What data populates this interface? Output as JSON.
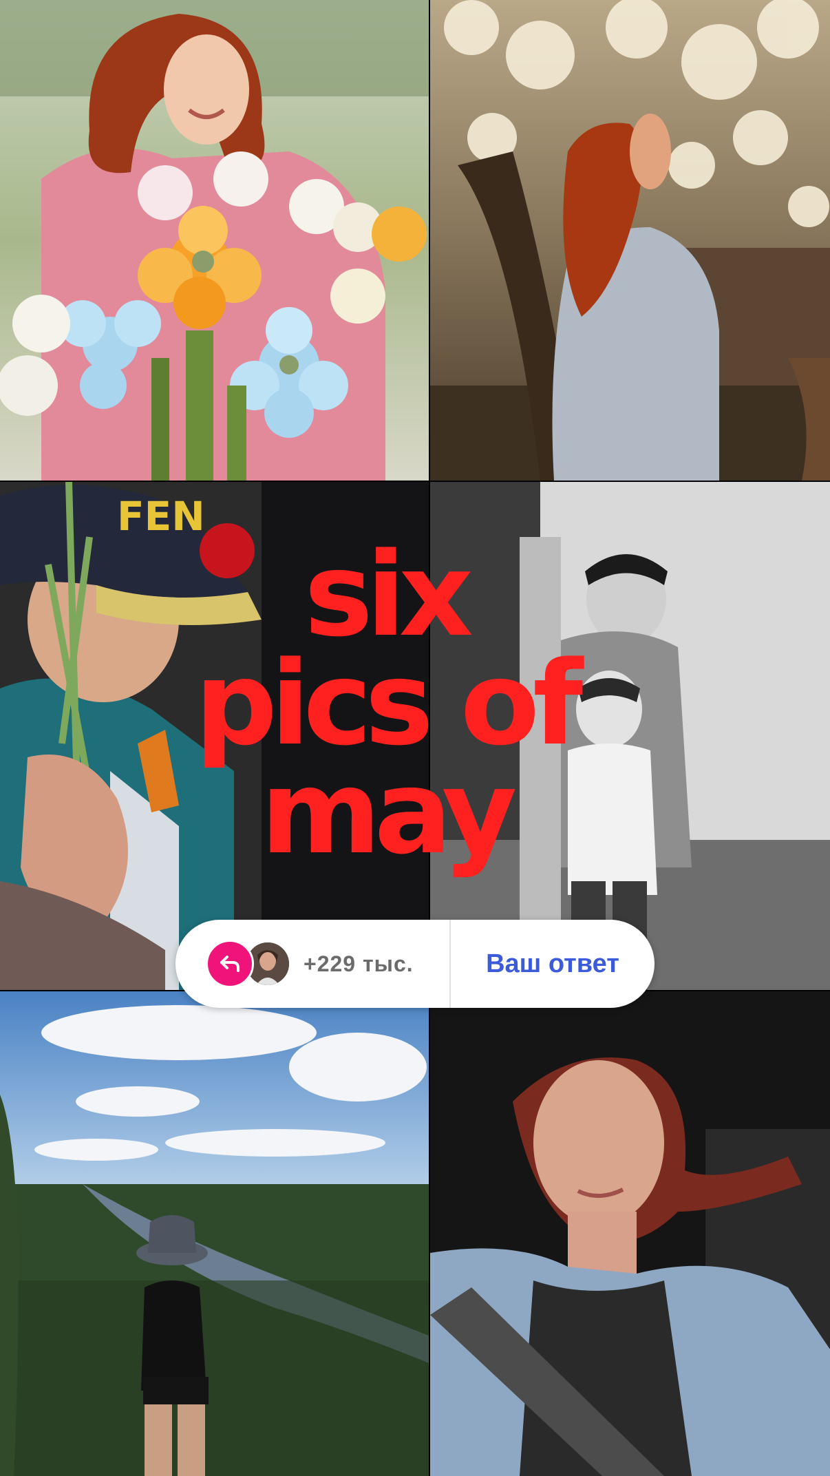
{
  "story": {
    "headline_lines": [
      "six",
      "pics of",
      "may"
    ],
    "headline_color": "#ff2020"
  },
  "photos": [
    {
      "id": "photo-1",
      "subject": "woman-with-balloon-flowers"
    },
    {
      "id": "photo-2",
      "subject": "woman-under-blossom-tree"
    },
    {
      "id": "photo-3",
      "subject": "boy-with-carnations"
    },
    {
      "id": "photo-4",
      "subject": "two-boys-bw"
    },
    {
      "id": "photo-5",
      "subject": "hiker-overlooking-river"
    },
    {
      "id": "photo-6",
      "subject": "selfie-in-car"
    }
  ],
  "reply_sticker": {
    "reply_icon": "reply-arrow-icon",
    "count_label": "+229 тыс.",
    "button_label": "Ваш ответ",
    "accent_color": "#3b5bdb",
    "icon_color": "#f0147a"
  },
  "overlay_text": {
    "cap_text": "FEN"
  }
}
